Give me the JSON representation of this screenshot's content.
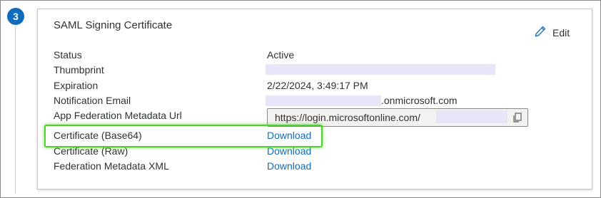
{
  "step": {
    "number": "3"
  },
  "card": {
    "title": "SAML Signing Certificate",
    "edit_label": "Edit"
  },
  "fields": {
    "status": {
      "label": "Status",
      "value": "Active"
    },
    "thumbprint": {
      "label": "Thumbprint",
      "value": ""
    },
    "expiration": {
      "label": "Expiration",
      "value": "2/22/2024, 3:49:17 PM"
    },
    "notification_email": {
      "label": "Notification Email",
      "value_suffix": ".onmicrosoft.com"
    },
    "metadata_url": {
      "label": "App Federation Metadata Url",
      "value": "https://login.microsoftonline.com/"
    },
    "cert_base64": {
      "label": "Certificate (Base64)",
      "link": "Download"
    },
    "cert_raw": {
      "label": "Certificate (Raw)",
      "link": "Download"
    },
    "federation_xml": {
      "label": "Federation Metadata XML",
      "link": "Download"
    }
  },
  "colors": {
    "accent": "#0f6cbd",
    "highlight": "#4ed32a",
    "redaction": "#e6e6f6"
  },
  "icons": {
    "edit": "pencil-icon",
    "copy": "copy-icon"
  }
}
